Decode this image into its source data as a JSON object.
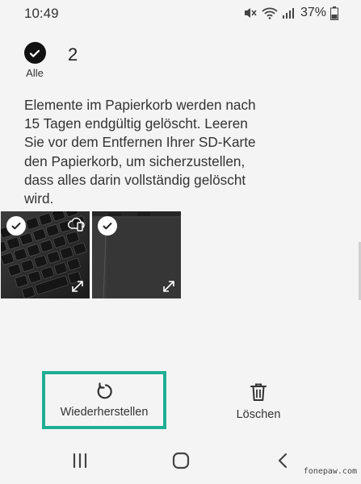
{
  "status": {
    "time": "10:49",
    "battery": "37%",
    "icons": [
      "mute-icon",
      "wifi-icon",
      "signal-icon",
      "battery-icon"
    ]
  },
  "selection": {
    "all_label": "Alle",
    "count": "2"
  },
  "info_text": "Elemente im Papierkorb werden nach 15 Tagen endgültig gelöscht. Leeren Sie vor dem Entfernen Ihrer SD-Karte den Papierkorb, um sicherzustellen, dass alles darin vollständig gelöscht wird.",
  "items": [
    {
      "name": "keyboard-photo",
      "selected": true,
      "icons": [
        "check-icon",
        "cloud-phone-icon",
        "expand-icon"
      ]
    },
    {
      "name": "touchpad-photo",
      "selected": true,
      "icons": [
        "check-icon",
        "expand-icon"
      ]
    }
  ],
  "actions": {
    "restore_label": "Wiederherstellen",
    "delete_label": "Löschen"
  },
  "highlight_color": "#1fae95",
  "watermark": "fonepaw.com"
}
